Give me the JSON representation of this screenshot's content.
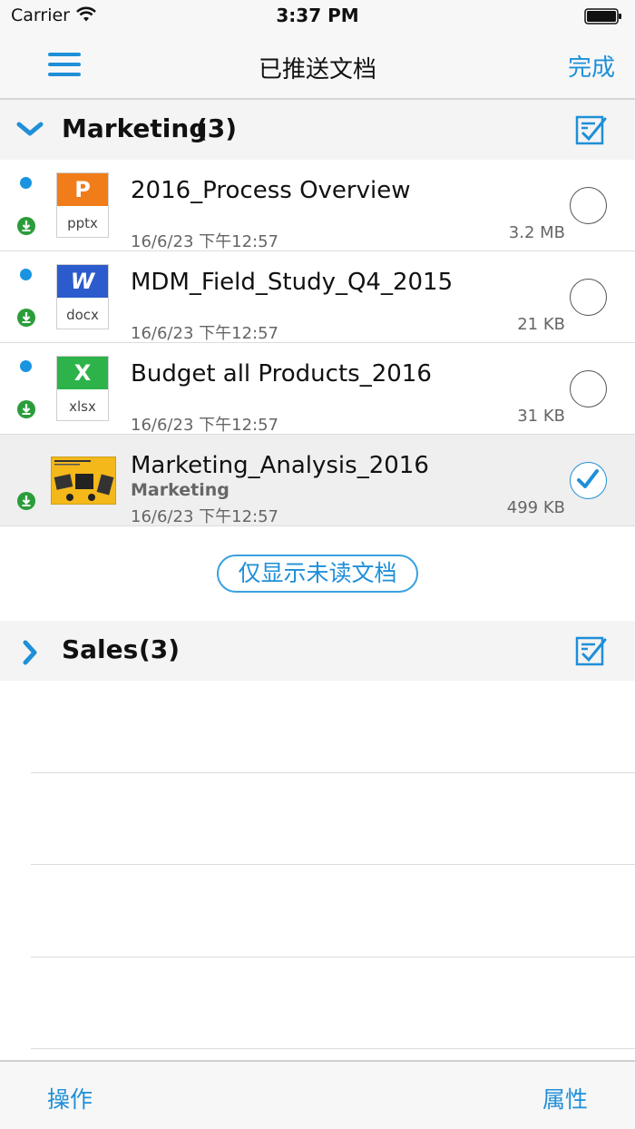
{
  "status_bar": {
    "carrier": "Carrier",
    "time": "3:37 PM",
    "icons": [
      "wifi-icon",
      "battery-icon"
    ]
  },
  "nav": {
    "title": "已推送文档",
    "done_label": "完成",
    "menu_icon": "hamburger-menu-icon"
  },
  "colors": {
    "accent": "#1f8fd8",
    "unread_dot": "#1a94e0",
    "download_green": "#2a9d3a",
    "pptx": "#f07d1a",
    "docx": "#2b5bcc",
    "xlsx": "#2db34a"
  },
  "sections": [
    {
      "title": "Marketing",
      "count": "(3)",
      "expanded": true,
      "items": [
        {
          "name": "2016_Process Overview",
          "subtitle": "",
          "date": "16/6/23 下午12:57",
          "size": "3.2 MB",
          "ext": "pptx",
          "glyph": "P",
          "unread": true,
          "downloaded": true,
          "selected": false
        },
        {
          "name": "MDM_Field_Study_Q4_2015",
          "subtitle": "",
          "date": "16/6/23 下午12:57",
          "size": "21 KB",
          "ext": "docx",
          "glyph": "W",
          "unread": true,
          "downloaded": true,
          "selected": false
        },
        {
          "name": "Budget all Products_2016",
          "subtitle": "",
          "date": "16/6/23 下午12:57",
          "size": "31 KB",
          "ext": "xlsx",
          "glyph": "X",
          "unread": true,
          "downloaded": true,
          "selected": false
        },
        {
          "name": "Marketing_Analysis_2016",
          "subtitle": "Marketing",
          "date": "16/6/23 下午12:57",
          "size": "499 KB",
          "ext": "",
          "glyph": "",
          "unread": false,
          "downloaded": true,
          "selected": true
        }
      ]
    },
    {
      "title": "Sales",
      "count": "(3)",
      "expanded": false,
      "items": []
    }
  ],
  "filter_button_label": "仅显示未读文档",
  "toolbar": {
    "actions_label": "操作",
    "properties_label": "属性"
  }
}
